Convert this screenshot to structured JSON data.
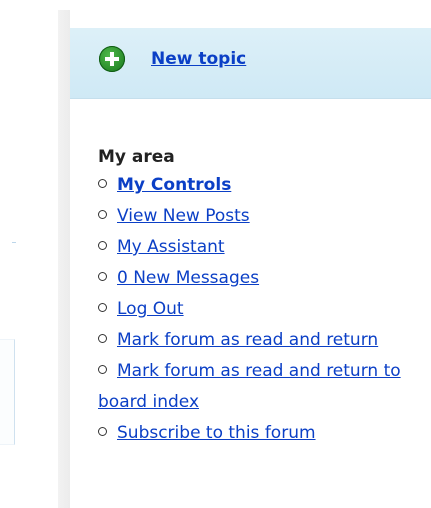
{
  "toolbar": {
    "new_topic_label": "New topic"
  },
  "my_area": {
    "title": "My area",
    "items": [
      {
        "label": "My Controls",
        "bold": true
      },
      {
        "label": "View New Posts"
      },
      {
        "label": "My Assistant"
      },
      {
        "label": "0 New Messages"
      },
      {
        "label": "Log Out"
      },
      {
        "label": "Mark forum as read and return"
      },
      {
        "label": "Mark forum as read and return to board index"
      },
      {
        "label": "Subscribe to this forum"
      }
    ]
  },
  "colors": {
    "link": "#0b3fc6",
    "new_topic_bar": "#d6edf7",
    "plus_icon": "#1e8a22"
  },
  "icons": {
    "new_topic": "plus-circle-icon",
    "bullet": "circle-bullet-icon"
  }
}
